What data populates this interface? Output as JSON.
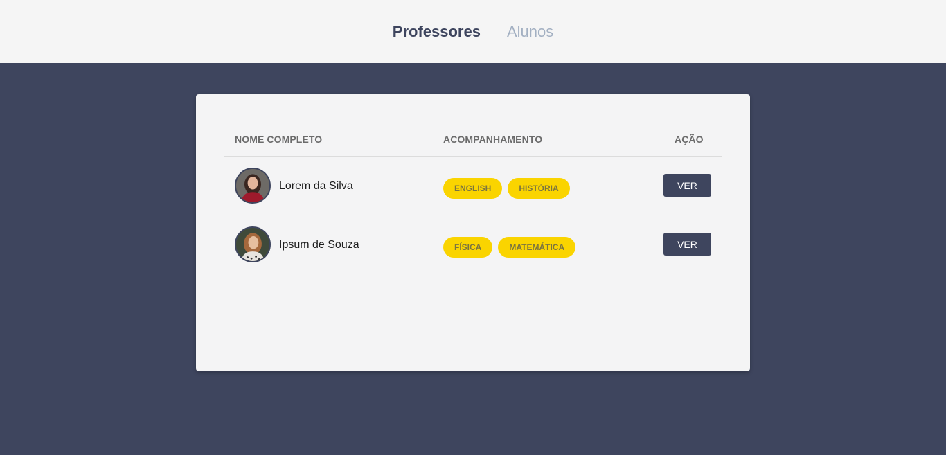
{
  "nav": {
    "tabs": [
      {
        "label": "Professores",
        "active": true
      },
      {
        "label": "Alunos",
        "active": false
      }
    ]
  },
  "table": {
    "headers": {
      "name": "NOME COMPLETO",
      "track": "ACOMPANHAMENTO",
      "action": "AÇÃO"
    },
    "rows": [
      {
        "name": "Lorem da Silva",
        "tags": [
          "ENGLISH",
          "HISTÓRIA"
        ],
        "action_label": "VER"
      },
      {
        "name": "Ipsum de Souza",
        "tags": [
          "FÍSICA",
          "MATEMÁTICA"
        ],
        "action_label": "VER"
      }
    ]
  },
  "colors": {
    "primary": "#3e455e",
    "accent": "#fad400",
    "surface": "#f4f4f5"
  }
}
